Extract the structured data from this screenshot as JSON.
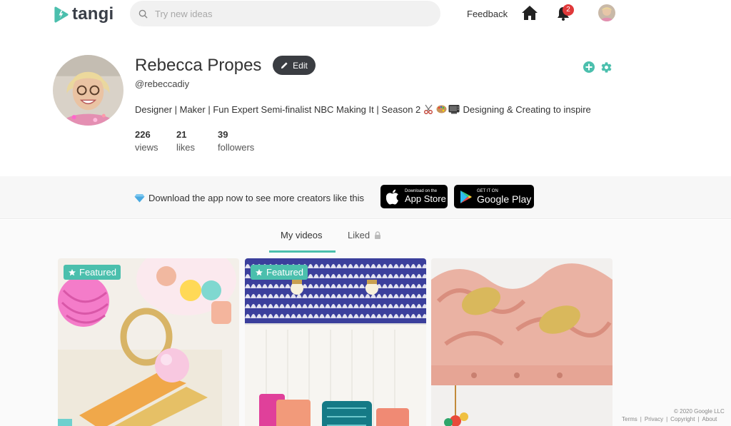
{
  "nav": {
    "logo_text": "tangi",
    "search_placeholder": "Try new ideas",
    "feedback_label": "Feedback",
    "notification_count": "2"
  },
  "profile": {
    "name": "Rebecca Propes",
    "edit_label": "Edit",
    "handle": "@rebeccadiy",
    "bio_before": "Designer | Maker | Fun Expert Semi-finalist NBC Making It | Season 2",
    "bio_after": "Designing & Creating to inspire",
    "stats": [
      {
        "value": "226",
        "label": "views"
      },
      {
        "value": "21",
        "label": "likes"
      },
      {
        "value": "39",
        "label": "followers"
      }
    ]
  },
  "banner": {
    "text": "Download the app now to see more creators like this",
    "appstore_small": "Download on the",
    "appstore_big": "App Store",
    "googleplay_small": "GET IT ON",
    "googleplay_big": "Google Play"
  },
  "tabs": [
    {
      "label": "My videos",
      "active": true
    },
    {
      "label": "Liked",
      "locked": true
    }
  ],
  "videos": [
    {
      "badge": "Featured",
      "subject": "craft bag with yarn and paint"
    },
    {
      "badge": "Featured",
      "subject": "patterned wallpaper reading nook"
    },
    {
      "badge": "",
      "subject": "pink carved bird hook rack"
    }
  ],
  "footer": {
    "copyright": "© 2020 Google LLC",
    "links": [
      "Terms",
      "Privacy",
      "Copyright",
      "About"
    ]
  },
  "colors": {
    "accent": "#4bbfad",
    "badge_red": "#e0393a",
    "dark_button": "#3a3d42"
  },
  "icons": [
    "tangi-logo-icon",
    "search-icon",
    "home-icon",
    "bell-icon",
    "avatar",
    "pencil-icon",
    "plus-circle-icon",
    "gear-icon",
    "diamond-icon",
    "apple-icon",
    "google-play-icon",
    "lock-icon",
    "star-icon"
  ]
}
